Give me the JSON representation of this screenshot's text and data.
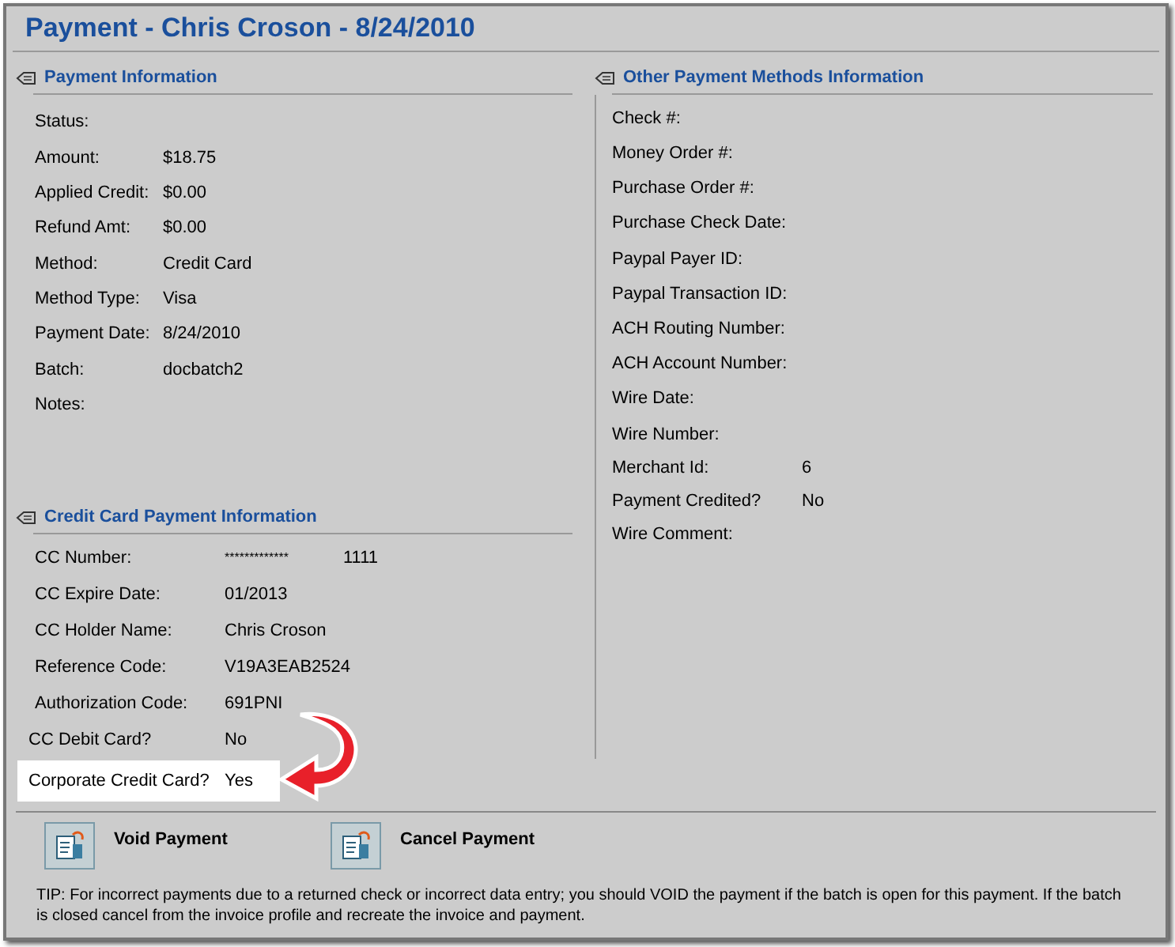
{
  "title": "Payment - Chris Croson - 8/24/2010",
  "payment_info": {
    "heading": "Payment Information",
    "fields": [
      {
        "label": "Status:"
      },
      {
        "label": "Amount:",
        "value": "$18.75"
      },
      {
        "label": "Applied Credit:",
        "value": "$0.00"
      },
      {
        "label": "Refund Amt:",
        "value": "$0.00"
      },
      {
        "label": "Method:",
        "value": "Credit Card"
      },
      {
        "label": "Method Type:",
        "value": "Visa"
      },
      {
        "label": "Payment Date:",
        "value": "8/24/2010"
      },
      {
        "label": "Batch:",
        "value": "docbatch2"
      },
      {
        "label": "Notes:"
      }
    ]
  },
  "credit_card_info": {
    "heading": "Credit Card Payment Information",
    "fields": [
      {
        "label": "CC Number:",
        "value": "*************",
        "value_2": "1111",
        "highlighted": false
      },
      {
        "label": "CC Expire Date:",
        "value": "01/2013",
        "highlighted": false
      },
      {
        "label": "CC Holder Name:",
        "value": "Chris Croson",
        "highlighted": false
      },
      {
        "label": "Reference Code:",
        "value": "V19A3EAB2524",
        "highlighted": false
      },
      {
        "label": "Authorization Code:",
        "value": "691PNI",
        "highlighted": false
      },
      {
        "label": "CC Debit Card?",
        "value": "No",
        "highlighted": false
      },
      {
        "label": "Corporate Credit Card?",
        "value": "Yes",
        "highlighted": true
      }
    ]
  },
  "other_methods": {
    "heading": "Other Payment Methods Information",
    "fields": [
      {
        "label": "Check #:"
      },
      {
        "label": "Money Order #:"
      },
      {
        "label": "Purchase Order #:"
      },
      {
        "label": "Purchase Check Date:"
      },
      {
        "label": "Paypal Payer ID:"
      },
      {
        "label": "Paypal Transaction ID:"
      },
      {
        "label": "ACH Routing Number:"
      },
      {
        "label": "ACH Account Number:"
      },
      {
        "label": "Wire Date:"
      },
      {
        "label": "Wire Number:"
      },
      {
        "label": "Merchant Id:",
        "value": "6"
      },
      {
        "label": "Payment Credited?",
        "value": "No"
      },
      {
        "label": "Wire Comment:"
      }
    ]
  },
  "actions": [
    "Void Payment",
    "Cancel Payment"
  ],
  "tip": "TIP: For incorrect payments due to a returned check or incorrect data entry; you should VOID the payment if the batch is open for this payment. If the batch is closed cancel from the invoice profile and recreate the invoice and payment."
}
